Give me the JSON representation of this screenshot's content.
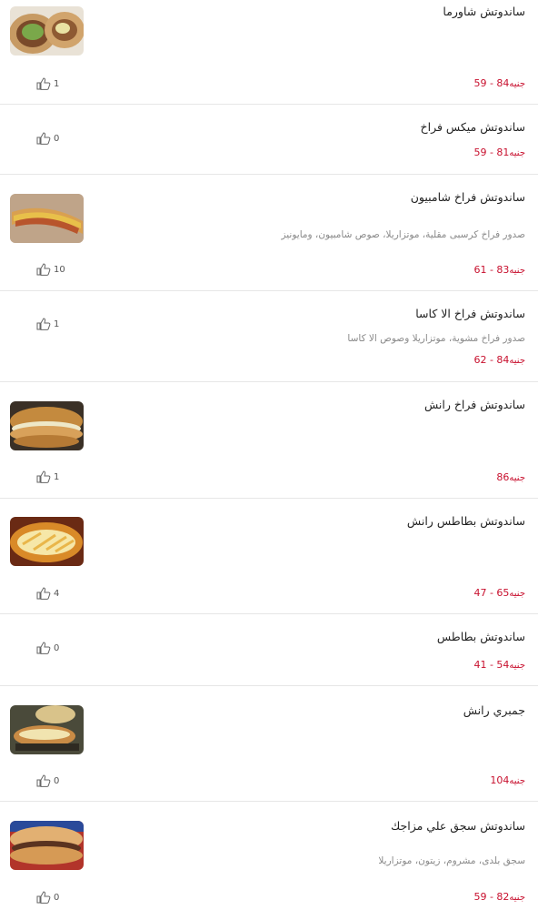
{
  "currency": "جنيه",
  "items": [
    {
      "name": "ساندوتش شاورما",
      "desc": "",
      "price_low": "59",
      "price_high": "84",
      "likes": "1",
      "has_image": true,
      "image": "shawarma wrap"
    },
    {
      "name": "ساندوتش ميكس فراخ",
      "desc": "",
      "price_low": "59",
      "price_high": "81",
      "likes": "0",
      "has_image": false
    },
    {
      "name": "ساندوتش فراخ شامبيون",
      "desc": "صدور فراخ كرسبى مقلية، موتزاريلا، صوص شامبيون، ومايونيز",
      "price_low": "61",
      "price_high": "83",
      "likes": "10",
      "has_image": true,
      "image": "crispy chicken sub"
    },
    {
      "name": "ساندوتش فراخ الا كاسا",
      "desc": "صدور فراخ مشوية، موتزاريلا وصوص الا كاسا",
      "price_low": "62",
      "price_high": "84",
      "likes": "1",
      "has_image": false
    },
    {
      "name": "ساندوتش فراخ رانش",
      "desc": "",
      "price_low": "",
      "price_high": "86",
      "likes": "1",
      "has_image": true,
      "image": "ranch chicken sub"
    },
    {
      "name": "ساندوتش بطاطس رانش",
      "desc": "",
      "price_low": "47",
      "price_high": "65",
      "likes": "4",
      "has_image": true,
      "image": "fries sub"
    },
    {
      "name": "ساندوتش بطاطس",
      "desc": "",
      "price_low": "41",
      "price_high": "54",
      "likes": "0",
      "has_image": false
    },
    {
      "name": "جمبري رانش",
      "desc": "",
      "price_low": "",
      "price_high": "104",
      "likes": "0",
      "has_image": true,
      "image": "shrimp sub"
    },
    {
      "name": "ساندوتش سجق علي مزاجك",
      "desc": "سجق بلدى، مشروم، زيتون، موتزاريلا",
      "price_low": "59",
      "price_high": "82",
      "likes": "0",
      "has_image": true,
      "image": "sausage sub"
    }
  ]
}
